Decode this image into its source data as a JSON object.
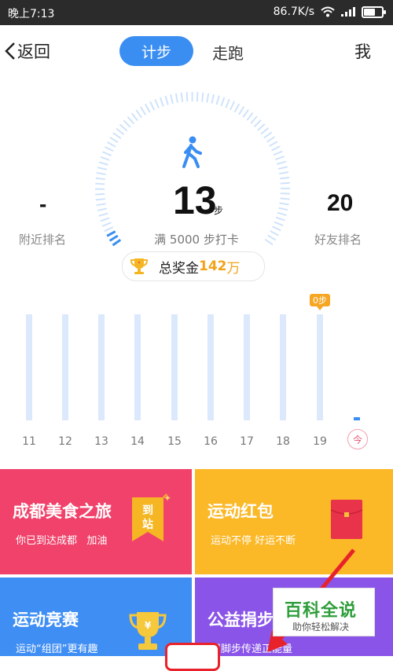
{
  "status": {
    "time": "晚上7:13",
    "speed": "86.7K/s"
  },
  "nav": {
    "back": "返回",
    "tab_active": "计步",
    "tab_run": "走跑",
    "me": "我"
  },
  "gauge": {
    "nearby_value": "-",
    "nearby_label": "附近排名",
    "steps": "13",
    "steps_unit": "步",
    "goal": "满 5000 步打卡",
    "friend_value": "20",
    "friend_label": "好友排名"
  },
  "prize": {
    "label": "总奖金",
    "value": "142",
    "unit": "万"
  },
  "chart_data": {
    "type": "bar",
    "categories": [
      "11",
      "12",
      "13",
      "14",
      "15",
      "16",
      "17",
      "18",
      "19",
      "今"
    ],
    "values": [
      0,
      0,
      0,
      0,
      0,
      0,
      0,
      0,
      0,
      13
    ],
    "tooltip": "0步"
  },
  "cards": [
    {
      "title": "成都美食之旅",
      "sub": "你已到达成都",
      "sub2": "加油",
      "badge": "到站",
      "color": "#f0426b"
    },
    {
      "title": "运动红包",
      "sub": "运动不停 好运不断",
      "color": "#fbb827"
    },
    {
      "title": "运动竞赛",
      "sub": "运动“组团”更有趣",
      "color": "#3f8ef4"
    },
    {
      "title": "公益捐步",
      "sub": "用脚步传递正能量",
      "color": "#8a54e8"
    }
  ],
  "watermark": {
    "main": "百科全说",
    "sub": "助你轻松解决"
  }
}
